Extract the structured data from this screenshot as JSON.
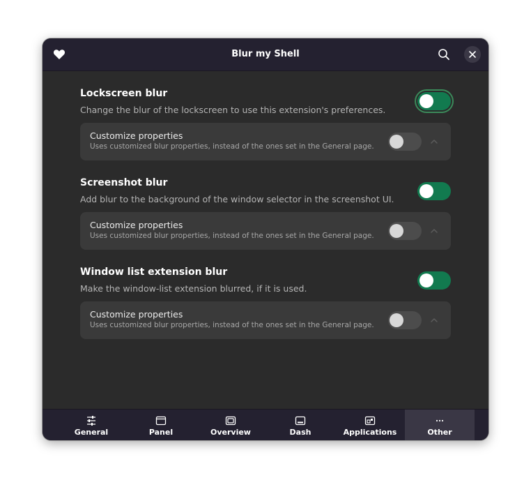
{
  "window": {
    "title": "Blur my Shell"
  },
  "rows": [
    {
      "title": "Lockscreen blur",
      "subtitle": "Change the blur of the lockscreen to use this extension's preferences.",
      "enabled": true,
      "card_title": "Customize properties",
      "card_subtitle": "Uses customized blur properties, instead of the ones set in the General page.",
      "card_enabled": false
    },
    {
      "title": "Screenshot blur",
      "subtitle": "Add blur to the background of the window selector in the screenshot UI.",
      "enabled": true,
      "card_title": "Customize properties",
      "card_subtitle": "Uses customized blur properties, instead of the ones set in the General page.",
      "card_enabled": false
    },
    {
      "title": "Window list extension blur",
      "subtitle": "Make the window-list extension blurred, if it is used.",
      "enabled": true,
      "card_title": "Customize properties",
      "card_subtitle": "Uses customized blur properties, instead of the ones set in the General page.",
      "card_enabled": false
    }
  ],
  "tabs": [
    {
      "label": "General",
      "icon": "sliders-icon",
      "active": false
    },
    {
      "label": "Panel",
      "icon": "panel-icon",
      "active": false
    },
    {
      "label": "Overview",
      "icon": "overview-icon",
      "active": false
    },
    {
      "label": "Dash",
      "icon": "dash-icon",
      "active": false
    },
    {
      "label": "Applications",
      "icon": "applications-icon",
      "active": false
    },
    {
      "label": "Other",
      "icon": "more-icon",
      "active": true
    }
  ],
  "colors": {
    "accent": "#127a4f",
    "headerbar": "#242130",
    "background": "#2b2b2b",
    "card": "#3a3a3a"
  }
}
